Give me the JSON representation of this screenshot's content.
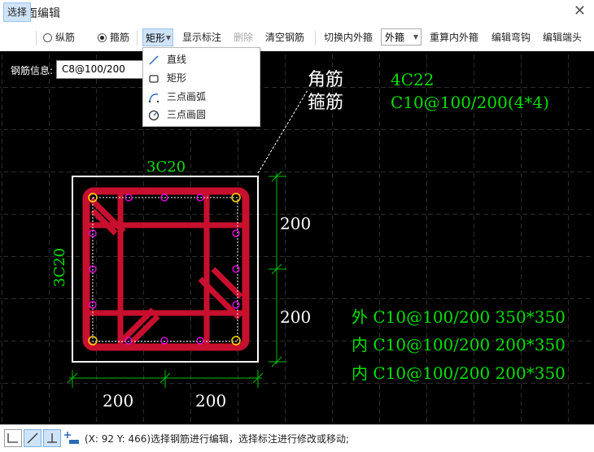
{
  "window": {
    "title": "截面编辑",
    "close": "✕"
  },
  "toolbar": {
    "select": "选择",
    "longitudinal": "纵筋",
    "stirrup": "箍筋",
    "shape": "矩形",
    "show_annotation": "显示标注",
    "delete": "删除",
    "clear": "清空钢筋",
    "switch_inner_outer": "切换内外箍",
    "hoop_type": "外箍",
    "recalc": "重算内外箍",
    "edit_bend": "编辑弯钩",
    "edit_end": "编辑端头"
  },
  "rebar_info": {
    "label": "钢筋信息:",
    "value": "C8@100/200"
  },
  "menu": {
    "items": [
      "直线",
      "矩形",
      "三点画弧",
      "三点画圆"
    ]
  },
  "annotations": {
    "corner_label": "角筋",
    "corner_value": "4C22",
    "stirrup_label": "箍筋",
    "stirrup_value": "C10@100/200(4*4)",
    "top": "3C20",
    "left": "3C20",
    "dim_top": "200",
    "dim_bottom_right": "200",
    "dim_bottom_a": "200",
    "dim_bottom_b": "200",
    "hoop1": "外 C10@100/200 350*350",
    "hoop2": "内 C10@100/200 200*350",
    "hoop3": "内 C10@100/200 200*350"
  },
  "status": {
    "text": "(X: 92 Y: 466)选择钢筋进行编辑，选择标注进行修改或移动;"
  },
  "colors": {
    "rebar": "#c8102e",
    "annotation": "#00e000",
    "corner_bar": "#ffd700",
    "side_bar": "#ff00ff"
  }
}
